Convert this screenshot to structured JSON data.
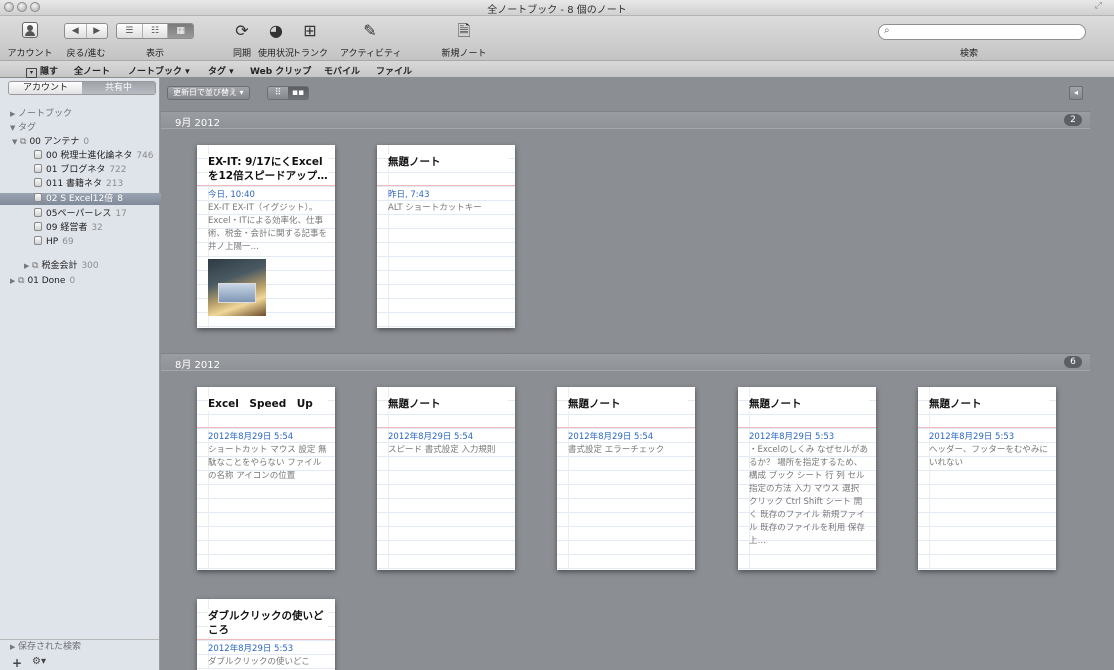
{
  "window": {
    "title": "全ノートブック - 8 個のノート"
  },
  "toolbar": {
    "account_label": "アカウント",
    "backfwd_label": "戻る/進む",
    "view_label": "表示",
    "sync_label": "同期",
    "usage_label": "使用状況",
    "trunk_label": "トランク",
    "activity_label": "アクティビティ",
    "new_note_label": "新規ノート",
    "search_label": "検索",
    "search_placeholder": ""
  },
  "menubar": {
    "items": [
      "隠す",
      "全ノート",
      "ノートブック ▾",
      "タグ ▾",
      "Web クリップ",
      "モバイル",
      "ファイル"
    ]
  },
  "sidebar": {
    "tabs": [
      "アカウント",
      "共有中"
    ],
    "sections": {
      "notebook": "ノートブック",
      "tags": "タグ",
      "saved_search": "保存された検索"
    },
    "tags": [
      {
        "label": "00 アンテナ",
        "count": "0"
      },
      {
        "label": "00 税理士進化論ネタ",
        "count": "746"
      },
      {
        "label": "01 ブログネタ",
        "count": "722"
      },
      {
        "label": "011 書籍ネタ",
        "count": "213"
      },
      {
        "label": "02 S Excel12倍",
        "count": "8"
      },
      {
        "label": "05ペーパーレス",
        "count": "17"
      },
      {
        "label": "09 経営者",
        "count": "32"
      },
      {
        "label": "HP",
        "count": "69"
      },
      {
        "label": "税金会計",
        "count": "300"
      },
      {
        "label": "01 Done",
        "count": "0"
      }
    ],
    "bottom_buttons": [
      "+",
      "⚙▾"
    ]
  },
  "main": {
    "sort_button": "更新日で並び替え ▾",
    "groups": [
      {
        "title": "9月 2012",
        "count": "2"
      },
      {
        "title": "8月 2012",
        "count": "6"
      }
    ],
    "cards": [
      {
        "title": "EX-IT: 9/17にくExcelを12倍スピードアップ…",
        "date": "今日, 10:40",
        "body": "EX-IT EX-IT（イグジット）。Excel・ITによる効率化、仕事術、税金・会計に関する記事を井ノ上陽一…"
      },
      {
        "title": "無題ノート",
        "date": "昨日, 7:43",
        "body": "ALT ショートカットキー"
      },
      {
        "title": "Excel　Speed　Up",
        "date": "2012年8月29日 5:54",
        "body": "ショートカット マウス 設定 無駄なことをやらない ファイルの名称 アイコンの位置"
      },
      {
        "title": "無題ノート",
        "date": "2012年8月29日 5:54",
        "body": "スピード 書式設定 入力規則"
      },
      {
        "title": "無題ノート",
        "date": "2012年8月29日 5:54",
        "body": "書式設定 エラーチェック"
      },
      {
        "title": "無題ノート",
        "date": "2012年8月29日 5:53",
        "body": "・Excelのしくみ なぜセルがあるか？ 場所を指定するため、構成 ブック シート 行 列 セル 指定の方法 入力 マウス 選択 クリック Ctrl Shift シート 開く 既存のファイル 新規ファイル 既存のファイルを利用 保存 上…"
      },
      {
        "title": "無題ノート",
        "date": "2012年8月29日 5:53",
        "body": "ヘッダー、フッターをむやみにいれない"
      },
      {
        "title": "ダブルクリックの使いどころ",
        "date": "2012年8月29日 5:53",
        "body": "ダブルクリックの使いどこ"
      }
    ]
  }
}
